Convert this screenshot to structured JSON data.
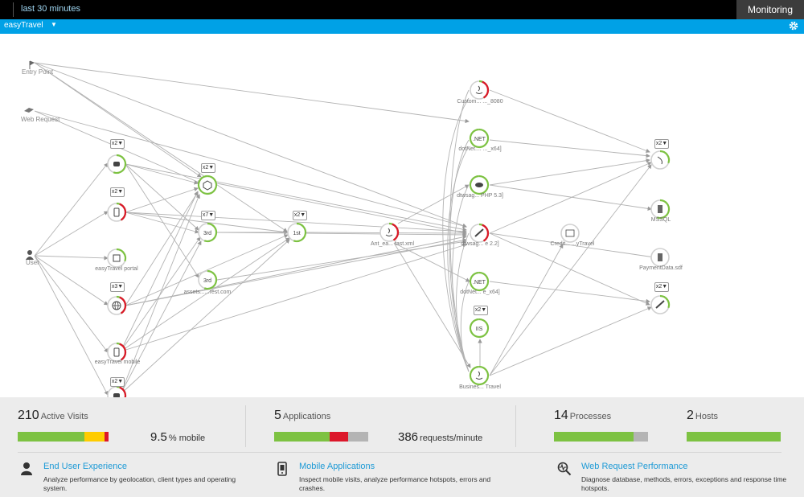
{
  "topbar": {
    "timeframe": "last 30 minutes",
    "perspective": "Monitoring"
  },
  "appbar": {
    "application": "easyTravel"
  },
  "nodes": {
    "entry_point": "Entry Point",
    "web_request": "Web Request",
    "user": "User",
    "easytravel_portal": "easyTravel portal",
    "assets": "assets......rest.com",
    "easytravel_mobile": "easyTravel mobile",
    "ant": "Ant_ea... fast.xml",
    "customer": "Custom... ..._8080",
    "dotnet1": "dotNet.... ..._x64]",
    "dtwsagent_php": "dtwsag... PHP 5.3]",
    "dtwsagent_22": "dtwsag... e 2.2]",
    "dotnet2": "dotNet... e_x64]",
    "business": "Busines... Travel",
    "credit": "Credit... ...yTravel",
    "mssql": "MSSQL",
    "paymentdata": "PaymentData.sdf",
    "net_label": ".NET",
    "iis_label": "IIS",
    "rank_3rd": "3rd",
    "rank_1st": "1st",
    "x2": "x2▼",
    "x3": "x3▼",
    "x7": "x7▼"
  },
  "stats": {
    "visits": {
      "value": "210",
      "label": "Active Visits",
      "mobile_value": "9.5",
      "mobile_label": "% mobile",
      "bar": [
        0.71,
        0.21,
        0.05
      ]
    },
    "applications": {
      "value": "5",
      "label": "Applications",
      "rpm_value": "386",
      "rpm_label": "requests/minute",
      "bar": [
        0.59,
        0.2,
        0.21
      ]
    },
    "processes": {
      "value": "14",
      "label": "Processes",
      "bar": [
        0.85,
        0.15
      ]
    },
    "hosts": {
      "value": "2",
      "label": "Hosts",
      "bar": [
        1.0
      ]
    }
  },
  "features": [
    {
      "title": "End User Experience",
      "desc": "Analyze performance by geolocation, client types and operating system.",
      "icon": "user-icon"
    },
    {
      "title": "Mobile Applications",
      "desc": "Inspect mobile visits, analyze performance hotspots, errors and crashes.",
      "icon": "mobile-icon"
    },
    {
      "title": "Web Request Performance",
      "desc": "Diagnose database, methods, errors, exceptions and response time hotspots.",
      "icon": "pulse-icon"
    }
  ],
  "colors": {
    "ok": "#7dc242",
    "warn": "#ffcc00",
    "error": "#dc172a",
    "neutral": "#b4b4b4",
    "accent": "#00a1e6"
  }
}
